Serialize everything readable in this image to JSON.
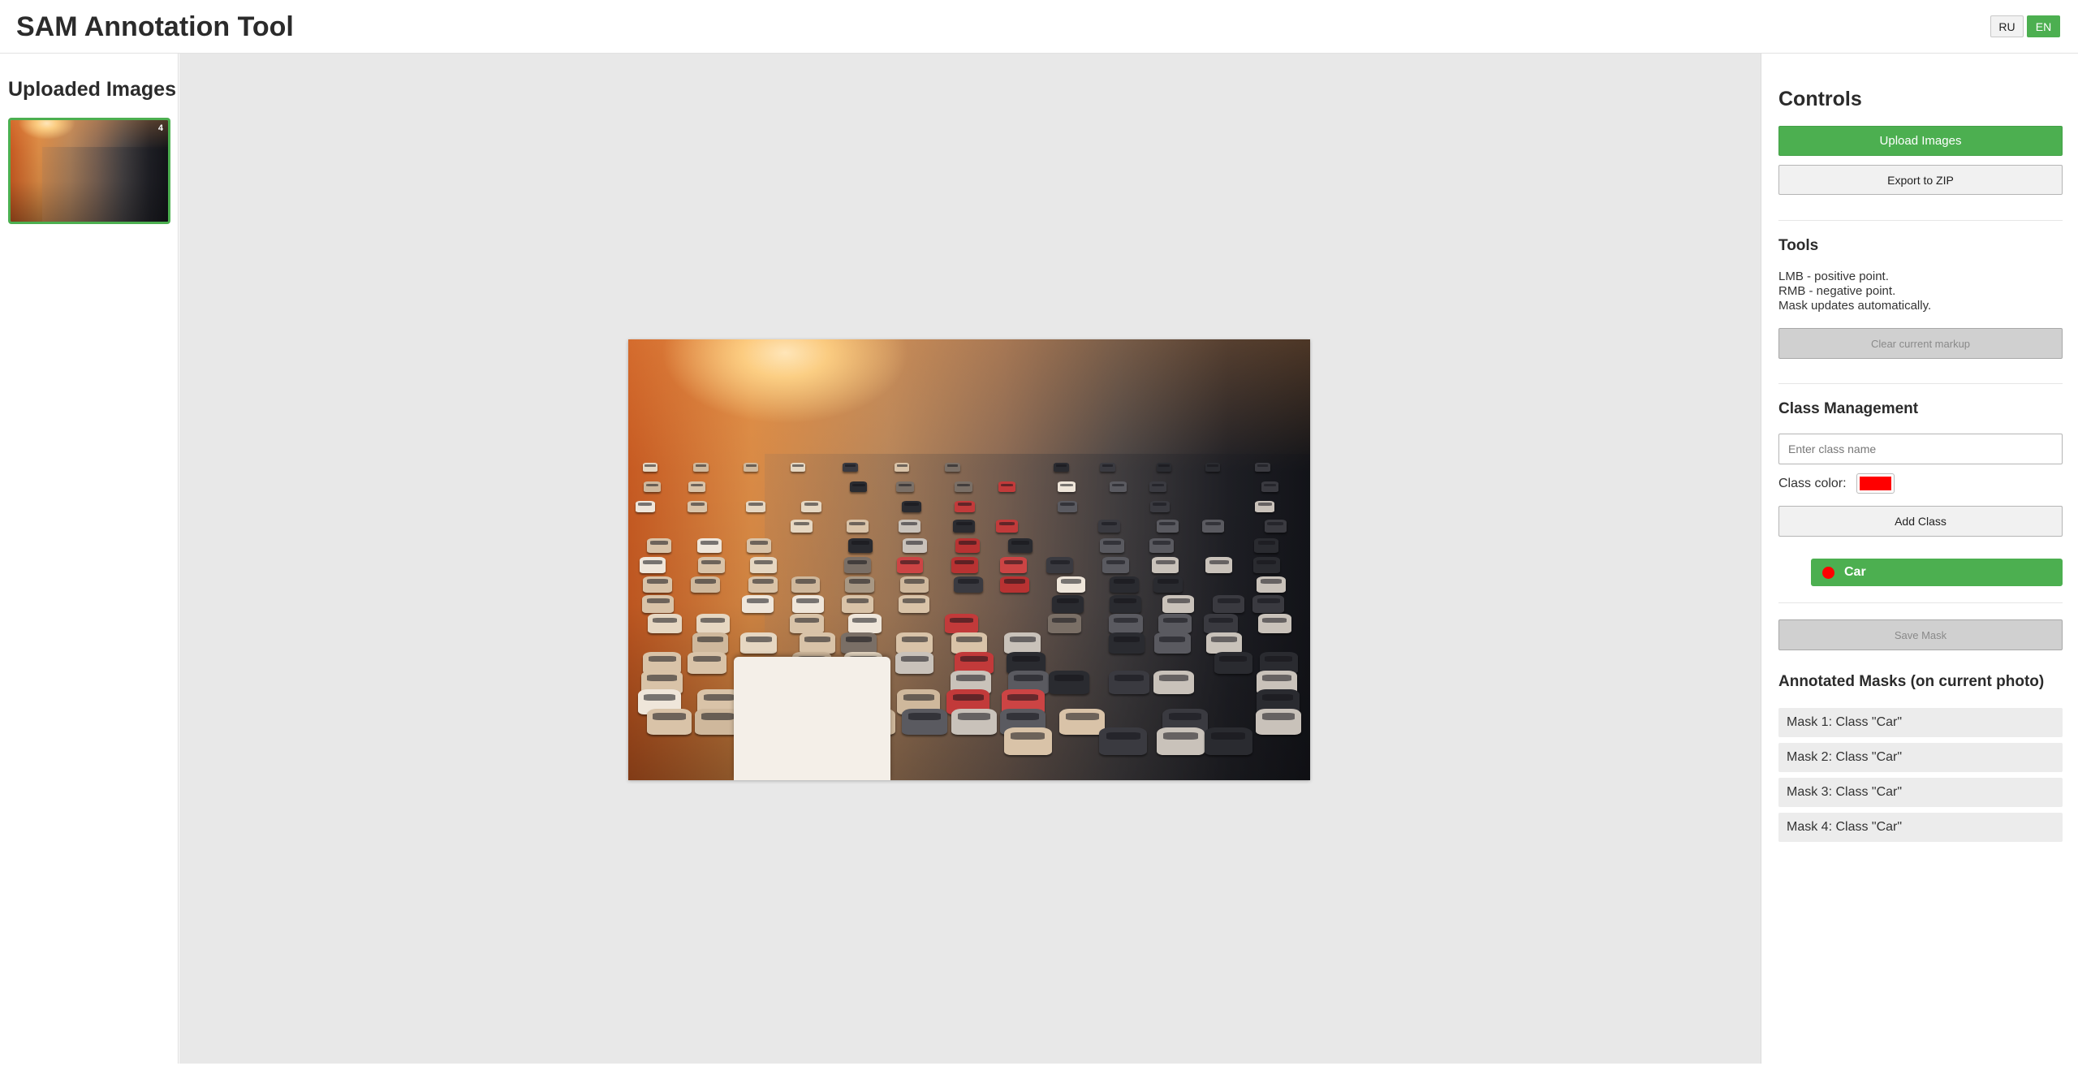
{
  "app": {
    "title": "SAM Annotation Tool",
    "languages": [
      {
        "code": "RU",
        "active": false
      },
      {
        "code": "EN",
        "active": true
      }
    ],
    "accent_color": "#4caf50"
  },
  "left_sidebar": {
    "title": "Uploaded Images",
    "thumbnails": [
      {
        "badge": "4",
        "selected": true
      }
    ]
  },
  "controls": {
    "title": "Controls",
    "upload_label": "Upload Images",
    "export_label": "Export to ZIP"
  },
  "tools": {
    "title": "Tools",
    "lines": [
      "LMB - positive point.",
      "RMB - negative point.",
      "Mask updates automatically."
    ],
    "clear_label": "Clear current markup",
    "clear_disabled": true
  },
  "class_management": {
    "title": "Class Management",
    "input_placeholder": "Enter class name",
    "input_value": "",
    "color_label": "Class color:",
    "color_value": "#ff0000",
    "add_label": "Add Class",
    "classes": [
      {
        "name": "Car",
        "color": "#ff0000",
        "selected": true
      }
    ],
    "save_label": "Save Mask",
    "save_disabled": true
  },
  "annotated_masks": {
    "title": "Annotated Masks (on current photo)",
    "items": [
      "Mask 1: Class \"Car\"",
      "Mask 2: Class \"Car\"",
      "Mask 3: Class \"Car\"",
      "Mask 4: Class \"Car\""
    ]
  }
}
